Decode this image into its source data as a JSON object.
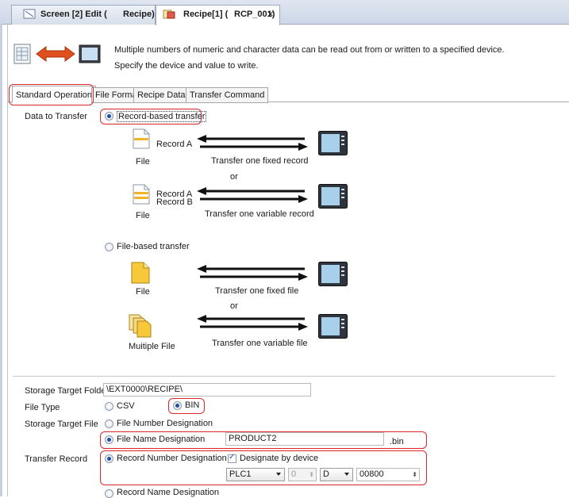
{
  "tabs": [
    {
      "label": "Screen [2] Edit (",
      "label2": "Recipe)",
      "active": false
    },
    {
      "label": "Recipe[1] (",
      "label2": "RCP_001)",
      "active": true
    }
  ],
  "close_glyph": "×",
  "description": {
    "line1": "Multiple numbers of numeric and character data can be read out from or written to a specified device.",
    "line2": "Specify the device and value to write."
  },
  "subtabs": [
    "Standard Operation",
    "File Format",
    "Recipe Data",
    "Transfer Command"
  ],
  "data_to_transfer": {
    "label": "Data to Transfer",
    "record_based": "Record-based transfer",
    "file_based": "File-based transfer",
    "record_a": "Record A",
    "record_a2": "Record A",
    "record_b": "Record B",
    "file": "File",
    "multiple_file": "Muitiple File",
    "fixed_record": "Transfer one fixed record",
    "variable_record": "Transfer one variable record",
    "fixed_file": "Transfer one fixed file",
    "variable_file": "Transfer one variable file",
    "or": "or"
  },
  "storage": {
    "folder_label": "Storage Target Folder",
    "folder_value": "\\EXT0000\\RECIPE\\",
    "file_type_label": "File Type",
    "csv": "CSV",
    "bin": "BIN",
    "target_file_label": "Storage Target File",
    "file_number": "File Number Designation",
    "file_name": "File Name Designation",
    "file_name_value": "PRODUCT2",
    "ext": ".bin"
  },
  "transfer_record": {
    "label": "Transfer Record",
    "record_number": "Record Number Designation",
    "designate_by_device": "Designate by device",
    "plc": "PLC1",
    "station": "0",
    "device_type": "D",
    "address": "00800",
    "record_name": "Record Name Designation"
  },
  "colors": {
    "highlight": "#d9262b",
    "radio_dot": "#1e4fa5"
  }
}
